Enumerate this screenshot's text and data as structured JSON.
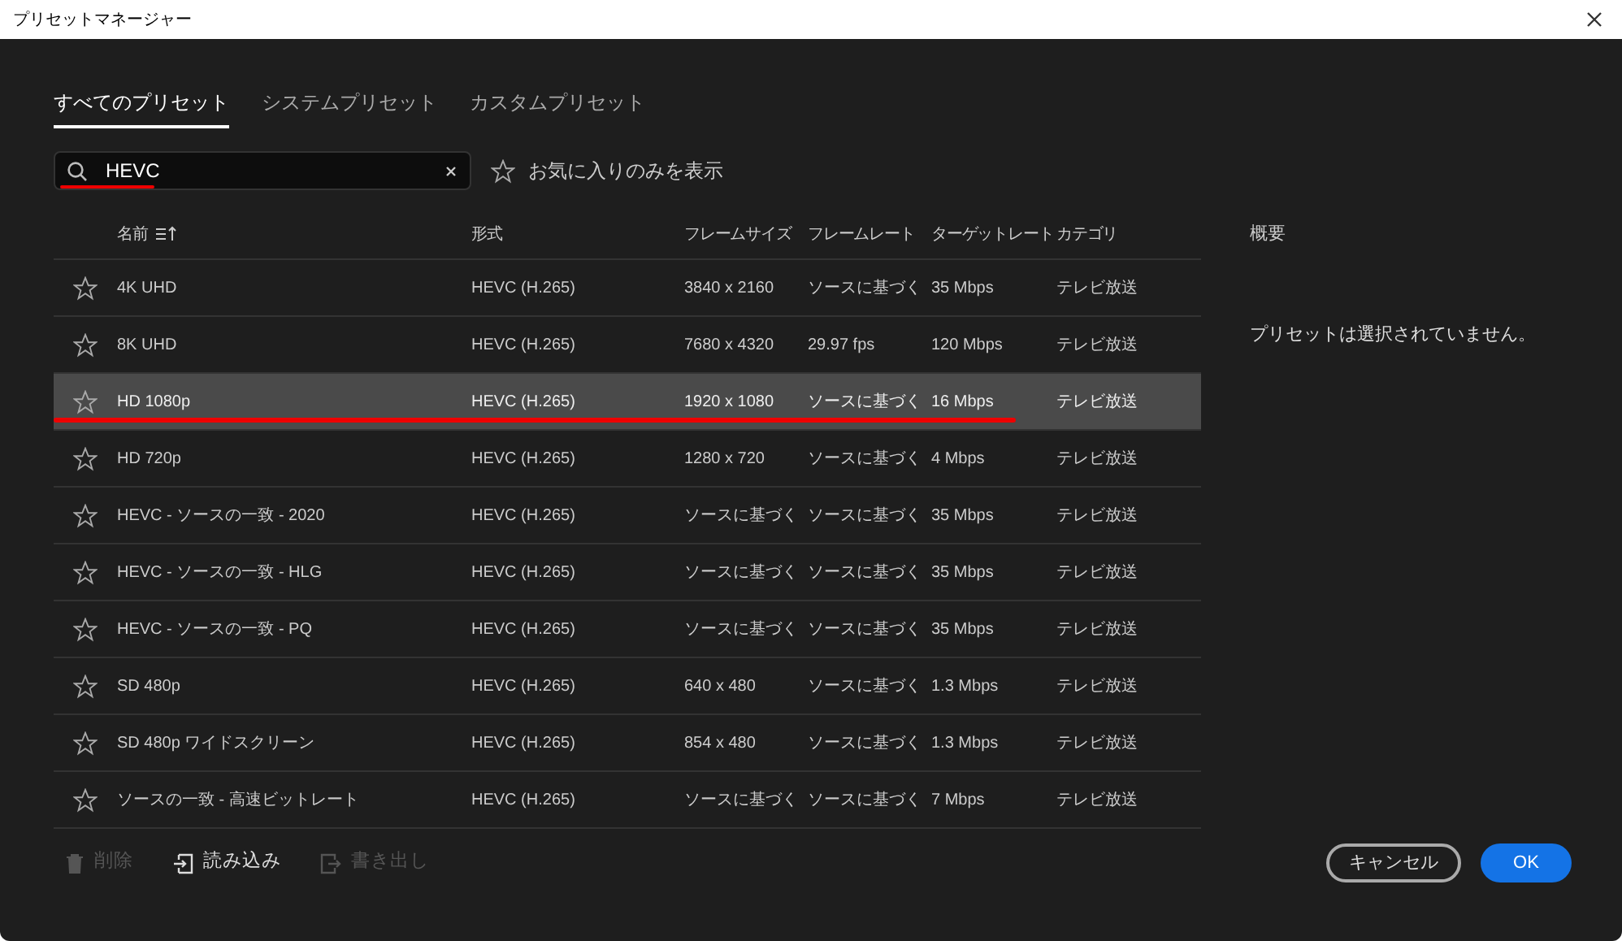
{
  "window": {
    "title": "プリセットマネージャー"
  },
  "tabs": [
    {
      "label": "すべてのプリセット",
      "selected": true
    },
    {
      "label": "システムプリセット",
      "selected": false
    },
    {
      "label": "カスタムプリセット",
      "selected": false
    }
  ],
  "search": {
    "value": "HEVC"
  },
  "favorites_only": {
    "label": "お気に入りのみを表示",
    "checked": false
  },
  "table": {
    "columns": [
      "名前",
      "形式",
      "フレームサイズ",
      "フレームレート",
      "ターゲットレート",
      "カテゴリ"
    ],
    "rows": [
      {
        "cells": [
          "4K UHD",
          "HEVC (H.265)",
          "3840 x 2160",
          "ソースに基づく",
          "35 Mbps",
          "テレビ放送"
        ],
        "favorite": false,
        "selected": false
      },
      {
        "cells": [
          "8K UHD",
          "HEVC (H.265)",
          "7680 x 4320",
          "29.97 fps",
          "120 Mbps",
          "テレビ放送"
        ],
        "favorite": false,
        "selected": false
      },
      {
        "cells": [
          "HD 1080p",
          "HEVC (H.265)",
          "1920 x 1080",
          "ソースに基づく",
          "16 Mbps",
          "テレビ放送"
        ],
        "favorite": false,
        "selected": true
      },
      {
        "cells": [
          "HD 720p",
          "HEVC (H.265)",
          "1280 x 720",
          "ソースに基づく",
          "4 Mbps",
          "テレビ放送"
        ],
        "favorite": false,
        "selected": false
      },
      {
        "cells": [
          "HEVC - ソースの一致 - 2020",
          "HEVC (H.265)",
          "ソースに基づく",
          "ソースに基づく",
          "35 Mbps",
          "テレビ放送"
        ],
        "favorite": false,
        "selected": false
      },
      {
        "cells": [
          "HEVC - ソースの一致 - HLG",
          "HEVC (H.265)",
          "ソースに基づく",
          "ソースに基づく",
          "35 Mbps",
          "テレビ放送"
        ],
        "favorite": false,
        "selected": false
      },
      {
        "cells": [
          "HEVC - ソースの一致 - PQ",
          "HEVC (H.265)",
          "ソースに基づく",
          "ソースに基づく",
          "35 Mbps",
          "テレビ放送"
        ],
        "favorite": false,
        "selected": false
      },
      {
        "cells": [
          "SD 480p",
          "HEVC (H.265)",
          "640 x 480",
          "ソースに基づく",
          "1.3 Mbps",
          "テレビ放送"
        ],
        "favorite": false,
        "selected": false
      },
      {
        "cells": [
          "SD 480p ワイドスクリーン",
          "HEVC (H.265)",
          "854 x 480",
          "ソースに基づく",
          "1.3 Mbps",
          "テレビ放送"
        ],
        "favorite": false,
        "selected": false
      },
      {
        "cells": [
          "ソースの一致 - 高速ビットレート",
          "HEVC (H.265)",
          "ソースに基づく",
          "ソースに基づく",
          "7 Mbps",
          "テレビ放送"
        ],
        "favorite": false,
        "selected": false
      }
    ]
  },
  "summary": {
    "heading": "概要",
    "text": "プリセットは選択されていません。"
  },
  "footer_actions": [
    {
      "label": "削除",
      "disabled": true,
      "kind": "delete"
    },
    {
      "label": "読み込み",
      "disabled": false,
      "kind": "import"
    },
    {
      "label": "書き出し",
      "disabled": true,
      "kind": "export"
    }
  ],
  "buttons": [
    {
      "label": "キャンセル",
      "kind": "secondary"
    },
    {
      "label": "OK",
      "kind": "primary"
    }
  ]
}
